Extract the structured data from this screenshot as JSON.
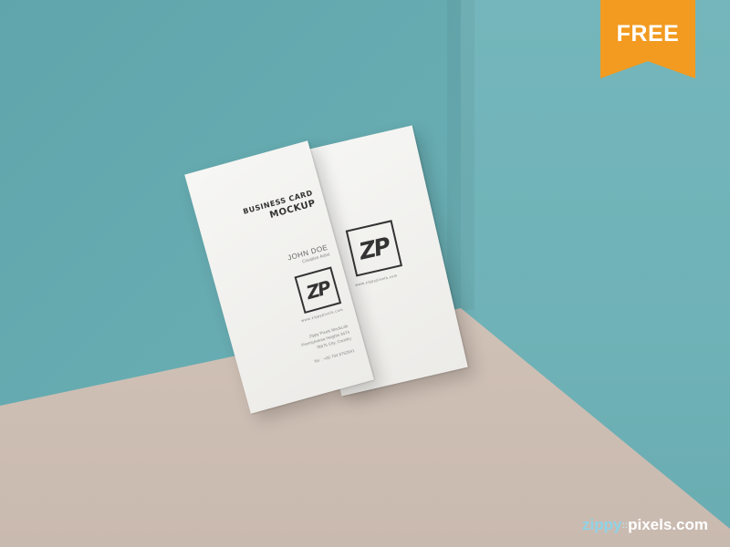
{
  "badge": {
    "label": "FREE",
    "color": "#f29b20"
  },
  "front_card": {
    "title_line1": "BUSINESS CARD",
    "title_line2": "MOCKUP",
    "name": "JOHN DOE",
    "role": "Creative Artist",
    "logo_text": "ZP",
    "website": "www.zippypixels.com",
    "address_line1": "Zippy Pixels MockLab",
    "address_line2": "Pennsylvania Heights 3474",
    "address_line3": "78675 City, Country",
    "phone": "Tel. : +00 704 8762941"
  },
  "back_card": {
    "logo_text": "ZP",
    "website": "www.zippypixels.com"
  },
  "watermark": {
    "part1": "zippy",
    "separator": "::",
    "part2": "pixels.com"
  },
  "colors": {
    "wall": "#64a9ae",
    "floor": "#d4c5ba",
    "card": "#f2f1ee"
  }
}
